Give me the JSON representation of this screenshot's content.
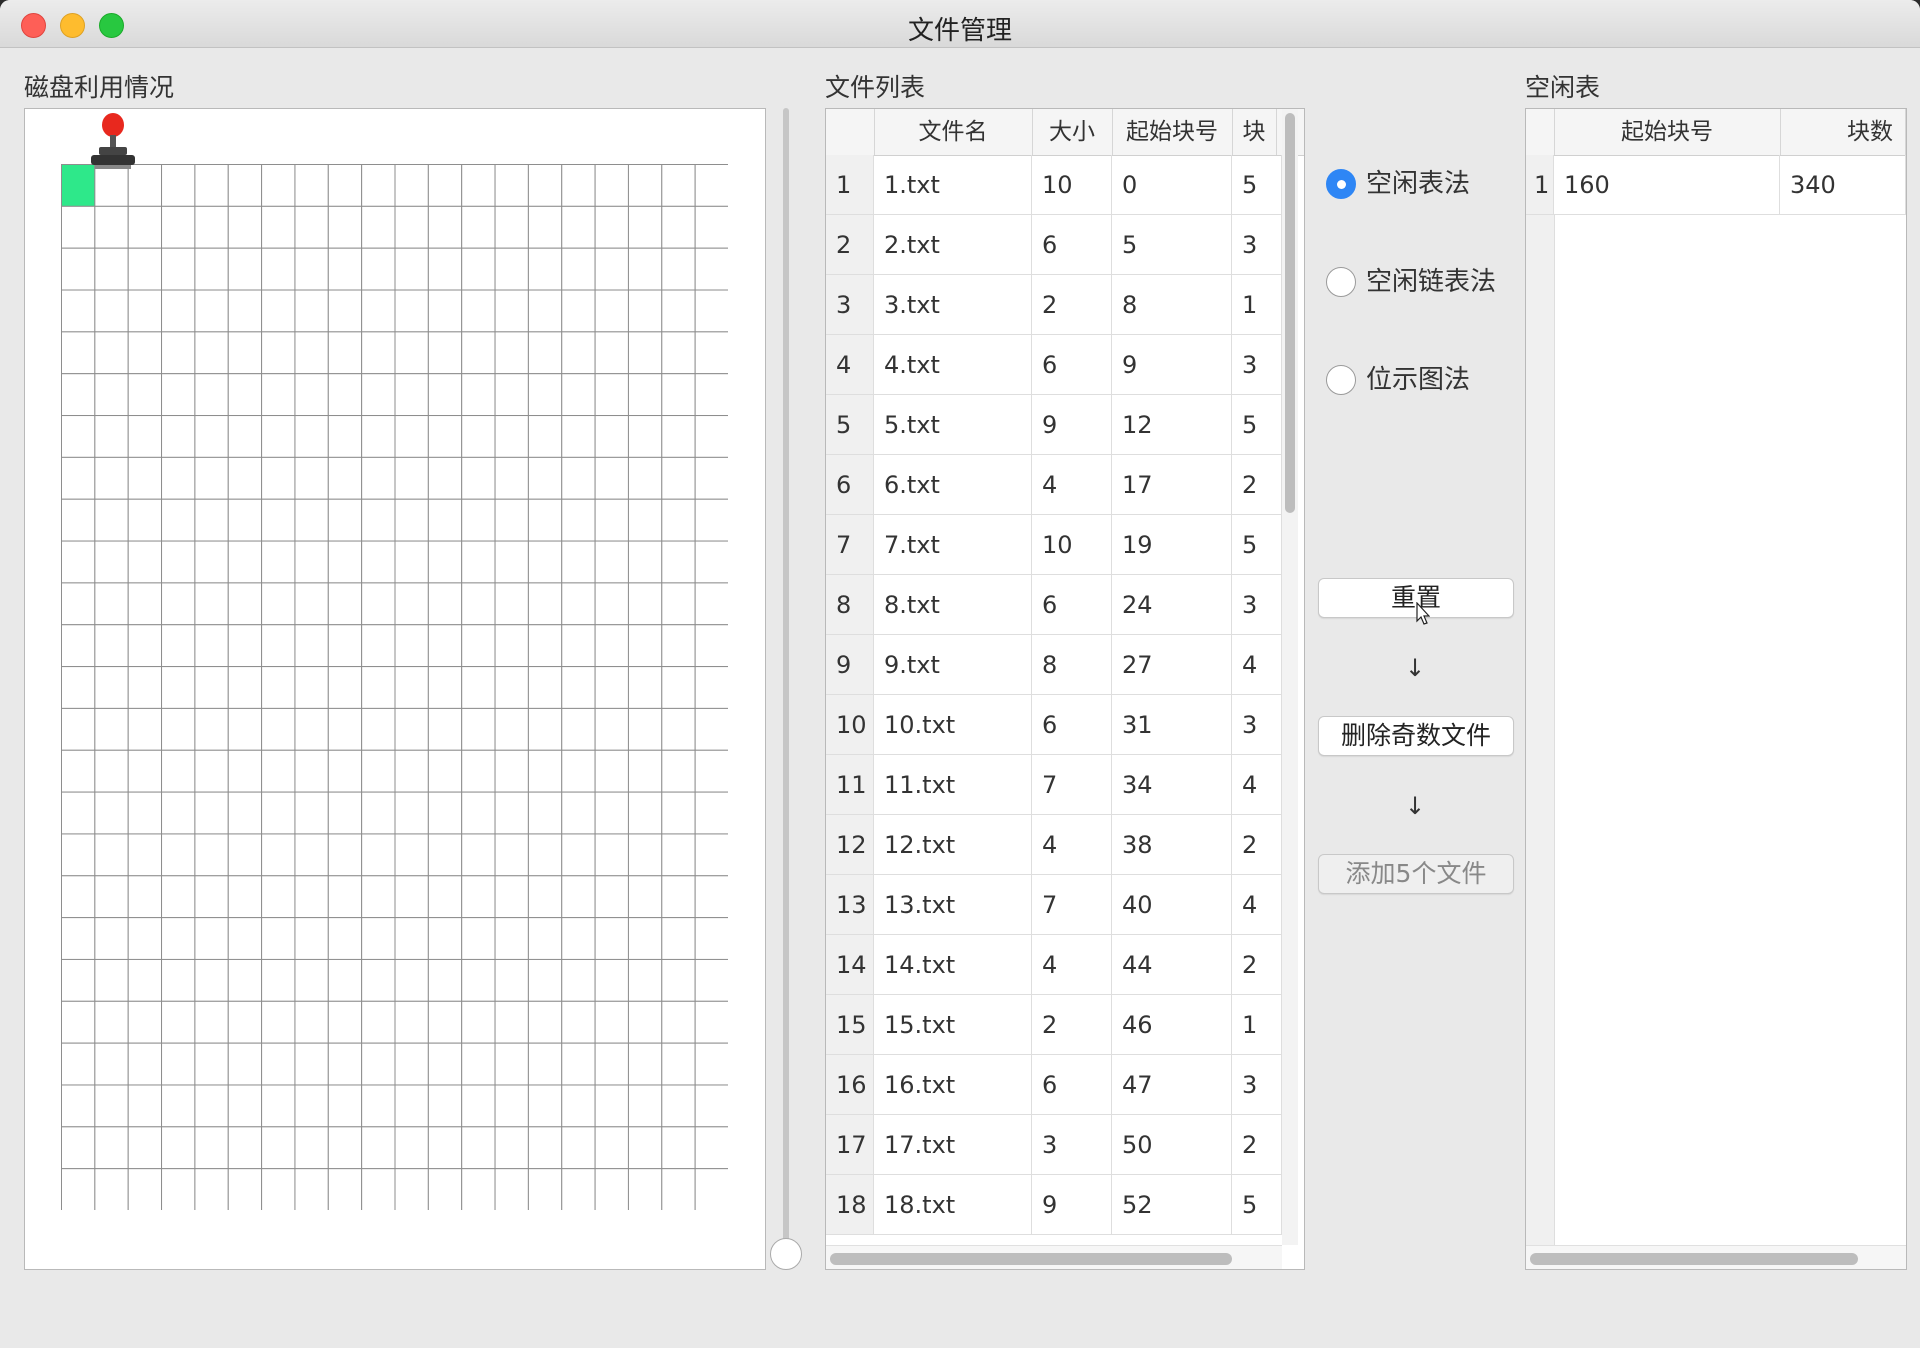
{
  "window": {
    "title": "文件管理"
  },
  "disk_panel": {
    "label": "磁盘利用情况",
    "grid": {
      "columns": 20,
      "rows": 25,
      "used_blocks": [
        0
      ]
    }
  },
  "file_list": {
    "label": "文件列表",
    "headers": {
      "name": "文件名",
      "size": "大小",
      "start": "起始块号",
      "blocks": "块"
    },
    "rows": [
      {
        "idx": "1",
        "name": "1.txt",
        "size": "10",
        "start": "0",
        "blocks": "5"
      },
      {
        "idx": "2",
        "name": "2.txt",
        "size": "6",
        "start": "5",
        "blocks": "3"
      },
      {
        "idx": "3",
        "name": "3.txt",
        "size": "2",
        "start": "8",
        "blocks": "1"
      },
      {
        "idx": "4",
        "name": "4.txt",
        "size": "6",
        "start": "9",
        "blocks": "3"
      },
      {
        "idx": "5",
        "name": "5.txt",
        "size": "9",
        "start": "12",
        "blocks": "5"
      },
      {
        "idx": "6",
        "name": "6.txt",
        "size": "4",
        "start": "17",
        "blocks": "2"
      },
      {
        "idx": "7",
        "name": "7.txt",
        "size": "10",
        "start": "19",
        "blocks": "5"
      },
      {
        "idx": "8",
        "name": "8.txt",
        "size": "6",
        "start": "24",
        "blocks": "3"
      },
      {
        "idx": "9",
        "name": "9.txt",
        "size": "8",
        "start": "27",
        "blocks": "4"
      },
      {
        "idx": "10",
        "name": "10.txt",
        "size": "6",
        "start": "31",
        "blocks": "3"
      },
      {
        "idx": "11",
        "name": "11.txt",
        "size": "7",
        "start": "34",
        "blocks": "4"
      },
      {
        "idx": "12",
        "name": "12.txt",
        "size": "4",
        "start": "38",
        "blocks": "2"
      },
      {
        "idx": "13",
        "name": "13.txt",
        "size": "7",
        "start": "40",
        "blocks": "4"
      },
      {
        "idx": "14",
        "name": "14.txt",
        "size": "4",
        "start": "44",
        "blocks": "2"
      },
      {
        "idx": "15",
        "name": "15.txt",
        "size": "2",
        "start": "46",
        "blocks": "1"
      },
      {
        "idx": "16",
        "name": "16.txt",
        "size": "6",
        "start": "47",
        "blocks": "3"
      },
      {
        "idx": "17",
        "name": "17.txt",
        "size": "3",
        "start": "50",
        "blocks": "2"
      },
      {
        "idx": "18",
        "name": "18.txt",
        "size": "9",
        "start": "52",
        "blocks": "5"
      }
    ]
  },
  "methods": {
    "selected": 0,
    "options": [
      "空闲表法",
      "空闲链表法",
      "位示图法"
    ]
  },
  "actions": {
    "reset": "重置",
    "arrow": "↓",
    "delete_odd": "删除奇数文件",
    "add_five": "添加5个文件"
  },
  "free_table": {
    "label": "空闲表",
    "headers": {
      "start": "起始块号",
      "count": "块数"
    },
    "rows": [
      {
        "idx": "1",
        "start": "160",
        "count": "340"
      }
    ]
  },
  "colors": {
    "accent": "#2e86f5",
    "used_block": "#2ee88a"
  }
}
